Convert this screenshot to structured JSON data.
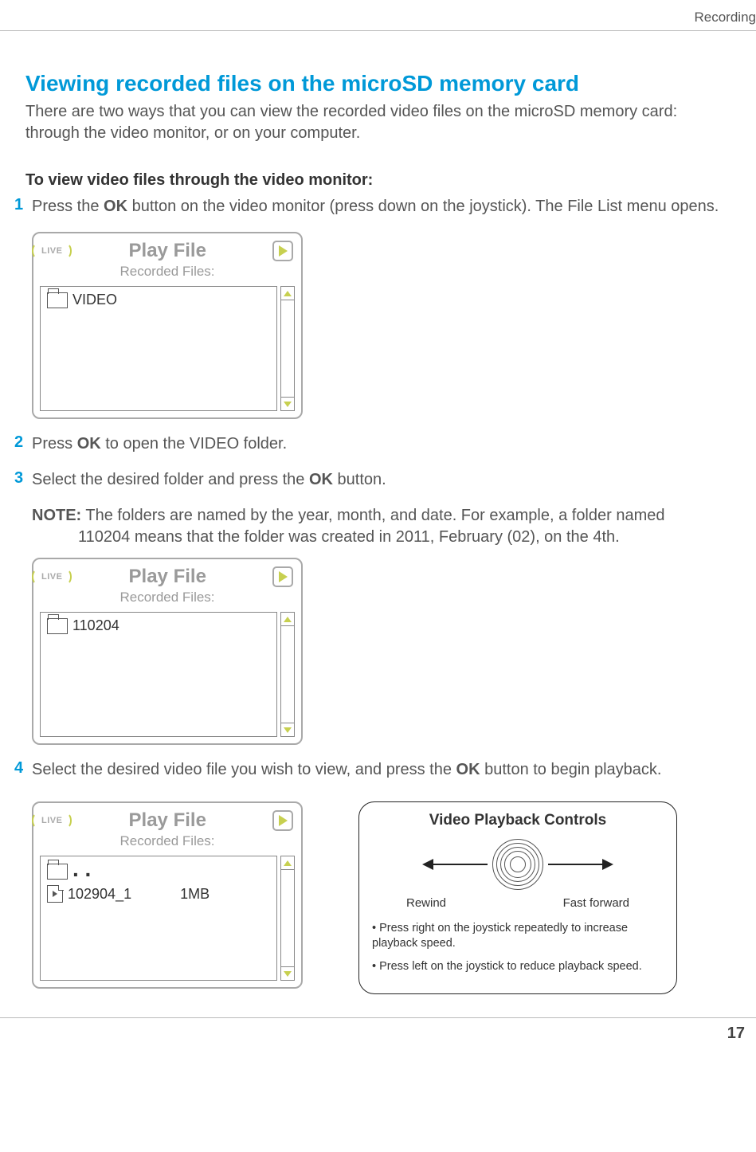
{
  "header": {
    "section": "Recording"
  },
  "title": "Viewing recorded files on the microSD memory card",
  "intro": "There are two ways that you can view the recorded video files on the microSD memory card: through the video monitor, or on your computer.",
  "subheading": "To view video files through the video monitor:",
  "steps": {
    "s1": {
      "num": "1",
      "pre": "Press the ",
      "bold1": "OK",
      "post": " button on the video monitor (press down on the joystick). The File List menu opens."
    },
    "s2": {
      "num": "2",
      "pre": "Press ",
      "bold1": "OK",
      "post": " to open the VIDEO folder."
    },
    "s3": {
      "num": "3",
      "pre": "Select the desired folder and press the ",
      "bold1": "OK",
      "post": " button."
    },
    "s4": {
      "num": "4",
      "pre": "Select the desired video file you wish to view, and press the ",
      "bold1": "OK",
      "post": " button to begin playback."
    }
  },
  "note": {
    "label": "NOTE:",
    "l1a": " The folders are named by the year, month, and date. For example, a folder named ",
    "fname": "110204",
    "l1b": " means that the folder was created in 20",
    "y": "11",
    "mid1": ", February (",
    "m": "02",
    "mid2": "), on the ",
    "d": "4",
    "end": "th."
  },
  "playfile": {
    "live": "LIVE",
    "title": "Play File",
    "subtitle": "Recorded Files:",
    "box1": {
      "folder": "VIDEO"
    },
    "box2": {
      "folder": "110204"
    },
    "box3": {
      "dotdot": ". .",
      "file": "102904_1",
      "size": "1MB"
    }
  },
  "controls": {
    "title": "Video Playback Controls",
    "rewind": "Rewind",
    "ff": "Fast forward",
    "b1": "• Press right on the joystick repeatedly to increase playback speed.",
    "b2": "• Press left on the joystick to reduce playback speed."
  },
  "pagenum": "17"
}
